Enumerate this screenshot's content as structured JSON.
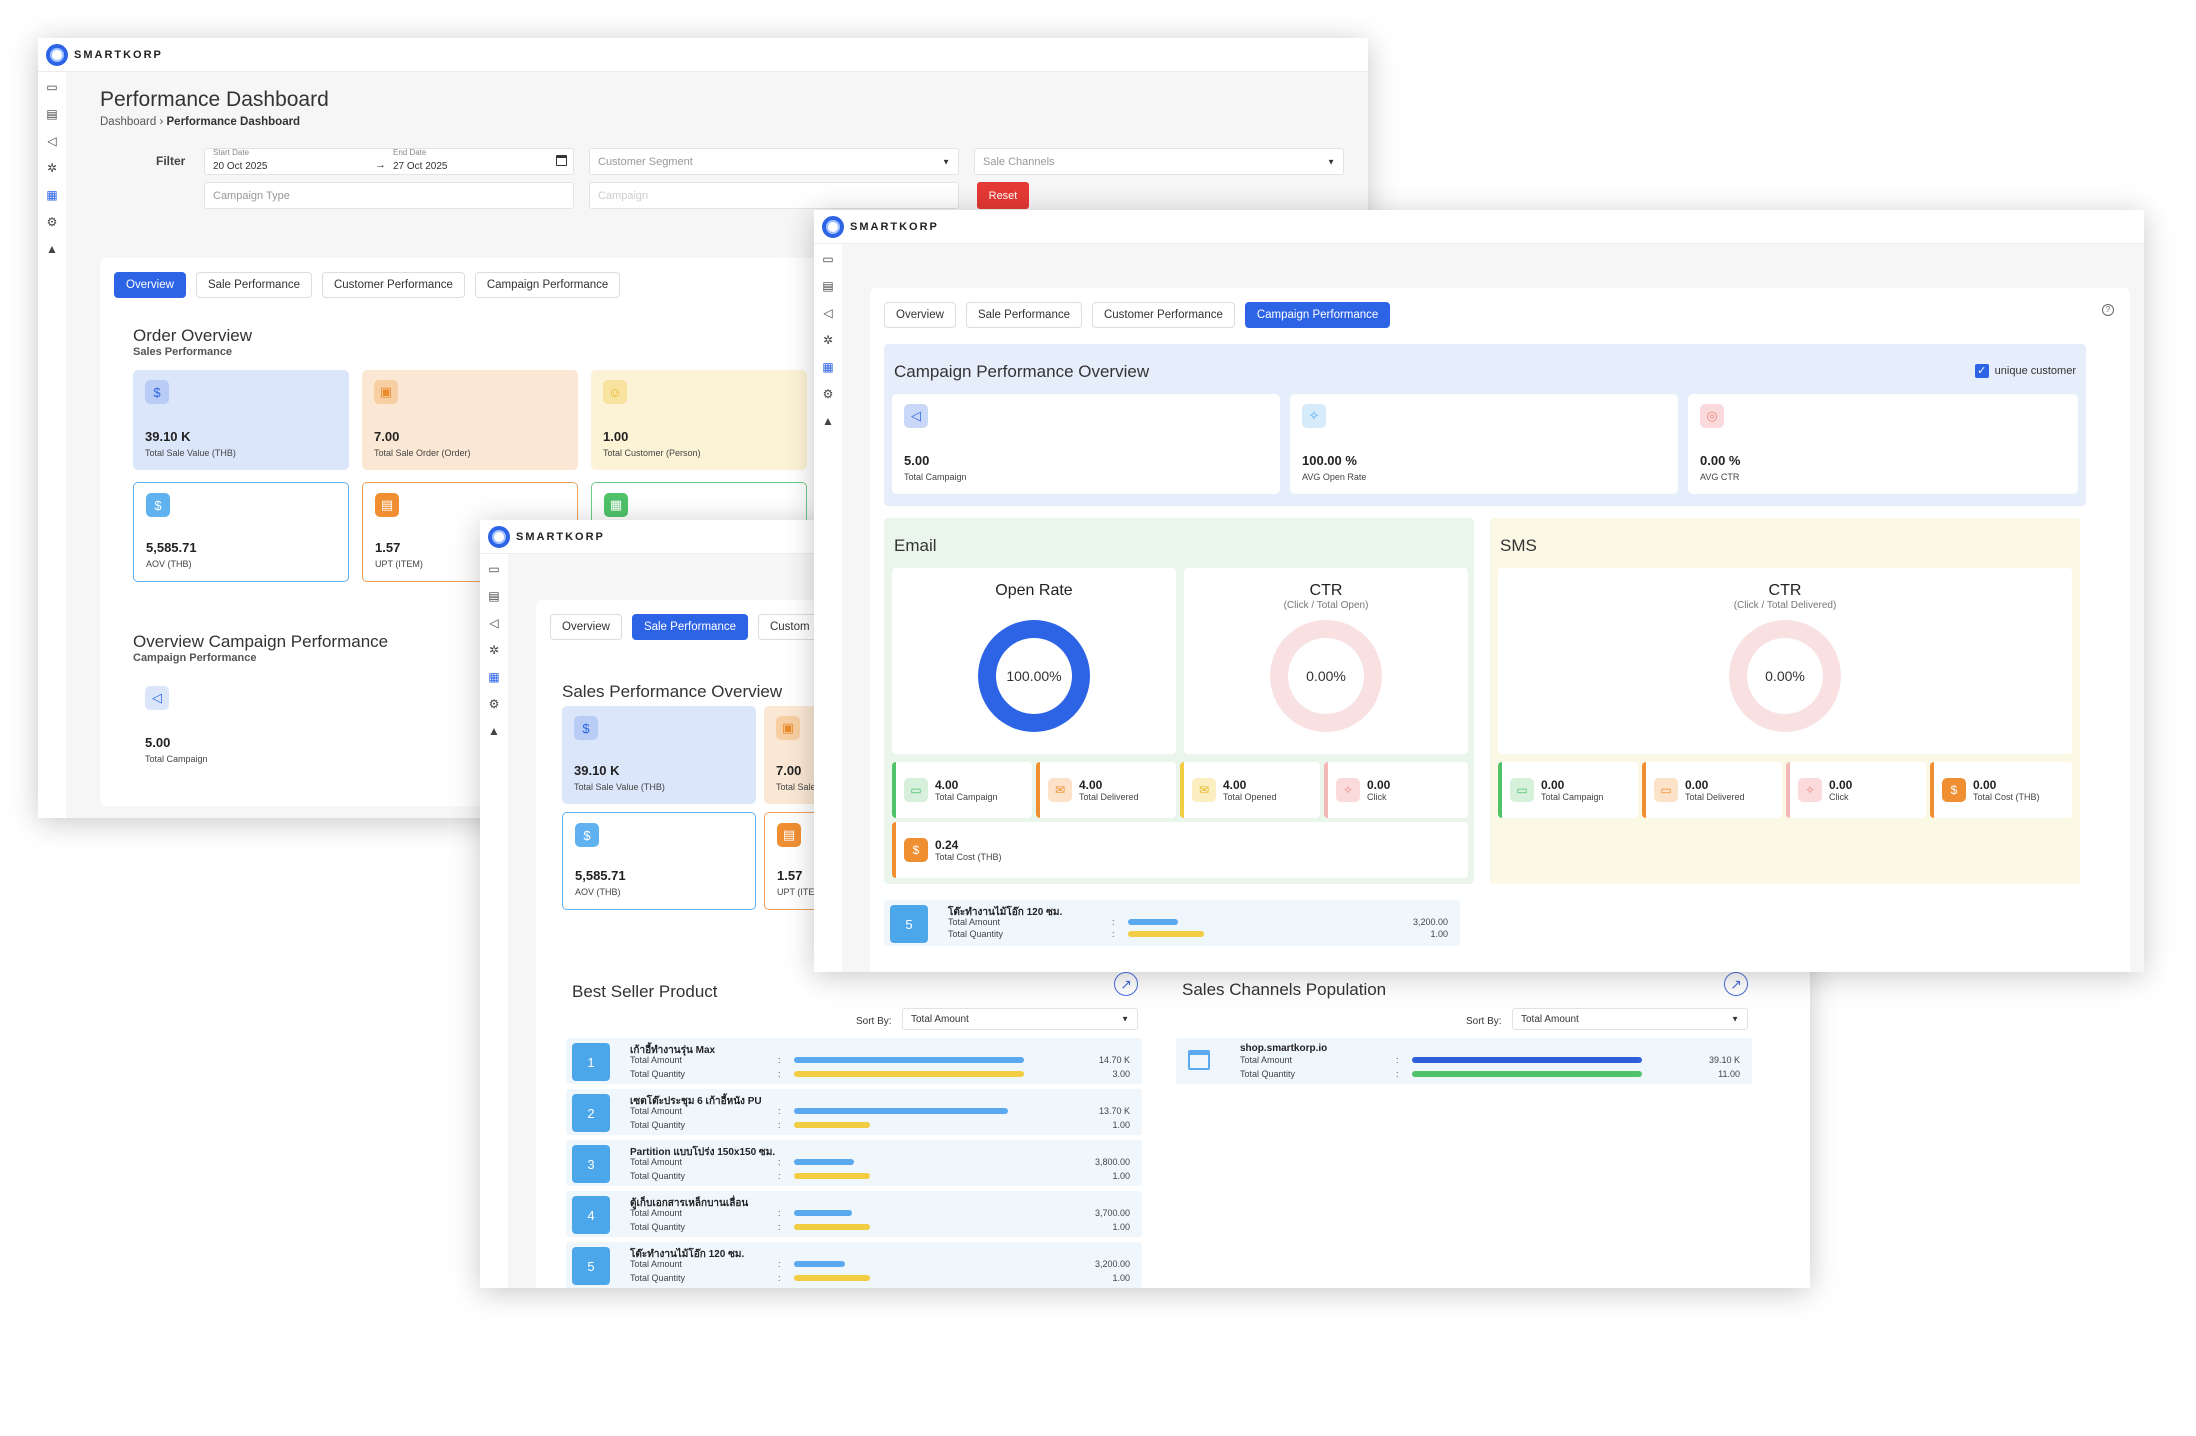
{
  "brand": "SMARTKORP",
  "sidebar_icons": [
    "calendar-icon",
    "document-icon",
    "megaphone-icon",
    "settings-icon",
    "dashboard-icon",
    "gear-icon",
    "thumbs-up-icon"
  ],
  "tabs": [
    "Overview",
    "Sale Performance",
    "Customer Performance",
    "Campaign Performance"
  ],
  "w1": {
    "title": "Performance Dashboard",
    "breadcrumb_root": "Dashboard",
    "breadcrumb_sep": "›",
    "breadcrumb_current": "Performance Dashboard",
    "filter_label": "Filter",
    "start_label": "Start Date",
    "start_value": "20 Oct 2025",
    "end_label": "End Date",
    "end_value": "27 Oct 2025",
    "arrow": "→",
    "segment_placeholder": "Customer Segment",
    "channels_placeholder": "Sale Channels",
    "campaign_type_placeholder": "Campaign Type",
    "campaign_placeholder": "Campaign",
    "reset": "Reset",
    "order_title": "Order Overview",
    "order_sub": "Sales Performance",
    "cards": [
      {
        "value": "39.10 K",
        "label": "Total Sale Value (THB)"
      },
      {
        "value": "7.00",
        "label": "Total Sale Order (Order)"
      },
      {
        "value": "1.00",
        "label": "Total Customer (Person)"
      },
      {
        "value": "5,585.71",
        "label": "AOV (THB)"
      },
      {
        "value": "1.57",
        "label": "UPT (ITEM)"
      }
    ],
    "camp_title": "Overview Campaign Performance",
    "camp_sub": "Campaign Performance",
    "camp_value": "5.00",
    "camp_label": "Total Campaign"
  },
  "w2": {
    "title": "Sales Performance Overview",
    "cards": [
      {
        "value": "39.10 K",
        "label": "Total Sale Value (THB)"
      },
      {
        "value": "7.00",
        "label": "Total Sale"
      },
      {
        "value": "5,585.71",
        "label": "AOV (THB)"
      },
      {
        "value": "1.57",
        "label": "UPT (ITEM)"
      }
    ],
    "tab_partial": "Custom",
    "best_title": "Best Seller Product",
    "sort_label": "Sort By:",
    "sort_value": "Total Amount",
    "amount_label": "Total Amount",
    "quantity_label": "Total Quantity",
    "colon": ":",
    "products": [
      {
        "rank": "1",
        "name": "เก้าอี้ทำงานรุ่น Max",
        "amount": "14.70 K",
        "qty": "3.00",
        "amount_frac": 1.0,
        "qty_frac": 1.0
      },
      {
        "rank": "2",
        "name": "เซตโต๊ะประชุม 6 เก้าอี้หนัง PU",
        "amount": "13.70 K",
        "qty": "1.00",
        "amount_frac": 0.93,
        "qty_frac": 0.33
      },
      {
        "rank": "3",
        "name": "Partition แบบโปร่ง 150x150 ซม.",
        "amount": "3,800.00",
        "qty": "1.00",
        "amount_frac": 0.26,
        "qty_frac": 0.33
      },
      {
        "rank": "4",
        "name": "ตู้เก็บเอกสารเหล็กบานเลื่อน",
        "amount": "3,700.00",
        "qty": "1.00",
        "amount_frac": 0.25,
        "qty_frac": 0.33
      },
      {
        "rank": "5",
        "name": "โต๊ะทำงานไม้โอ๊ก 120 ซม.",
        "amount": "3,200.00",
        "qty": "1.00",
        "amount_frac": 0.22,
        "qty_frac": 0.33
      }
    ],
    "channels_title": "Sales Channels Population",
    "channel": {
      "name": "shop.smartkorp.io",
      "amount": "39.10 K",
      "qty": "11.00",
      "amount_frac": 1.0,
      "qty_frac": 1.0
    },
    "expand_icon": "↗"
  },
  "w3": {
    "title": "Campaign Performance Overview",
    "unique_label": "unique customer",
    "cards": [
      {
        "value": "5.00",
        "label": "Total Campaign"
      },
      {
        "value": "100.00 %",
        "label": "AVG Open Rate"
      },
      {
        "value": "0.00 %",
        "label": "AVG CTR"
      }
    ],
    "email_title": "Email",
    "sms_title": "SMS",
    "open_rate_title": "Open Rate",
    "open_rate_value": "100.00%",
    "open_rate_frac": 1.0,
    "ctr_title": "CTR",
    "ctr_sub_email": "(Click / Total Open)",
    "ctr_value": "0.00%",
    "ctr_frac": 0.0,
    "ctr_sub_sms": "(Click / Total Delivered)",
    "sms_ctr_value": "0.00%",
    "email_stats": [
      {
        "value": "4.00",
        "label": "Total Campaign"
      },
      {
        "value": "4.00",
        "label": "Total Delivered"
      },
      {
        "value": "4.00",
        "label": "Total Opened"
      },
      {
        "value": "0.00",
        "label": "Click"
      },
      {
        "value": "0.24",
        "label": "Total Cost (THB)"
      }
    ],
    "sms_stats": [
      {
        "value": "0.00",
        "label": "Total Campaign"
      },
      {
        "value": "0.00",
        "label": "Total Delivered"
      },
      {
        "value": "0.00",
        "label": "Click"
      },
      {
        "value": "0.00",
        "label": "Total Cost (THB)"
      }
    ],
    "help_icon": "?",
    "peek": {
      "rank": "5",
      "name": "โต๊ะทำงานไม้โอ๊ก 120 ซม.",
      "amount": "3,200.00",
      "qty": "1.00"
    }
  },
  "colors": {
    "primary": "#2d63e5",
    "blue_bar": "#5aa8ee",
    "yellow_bar": "#f2cd41",
    "green_bar": "#4fc26a",
    "dark_blue_bar": "#2f5fd8",
    "reset": "#e53935"
  }
}
